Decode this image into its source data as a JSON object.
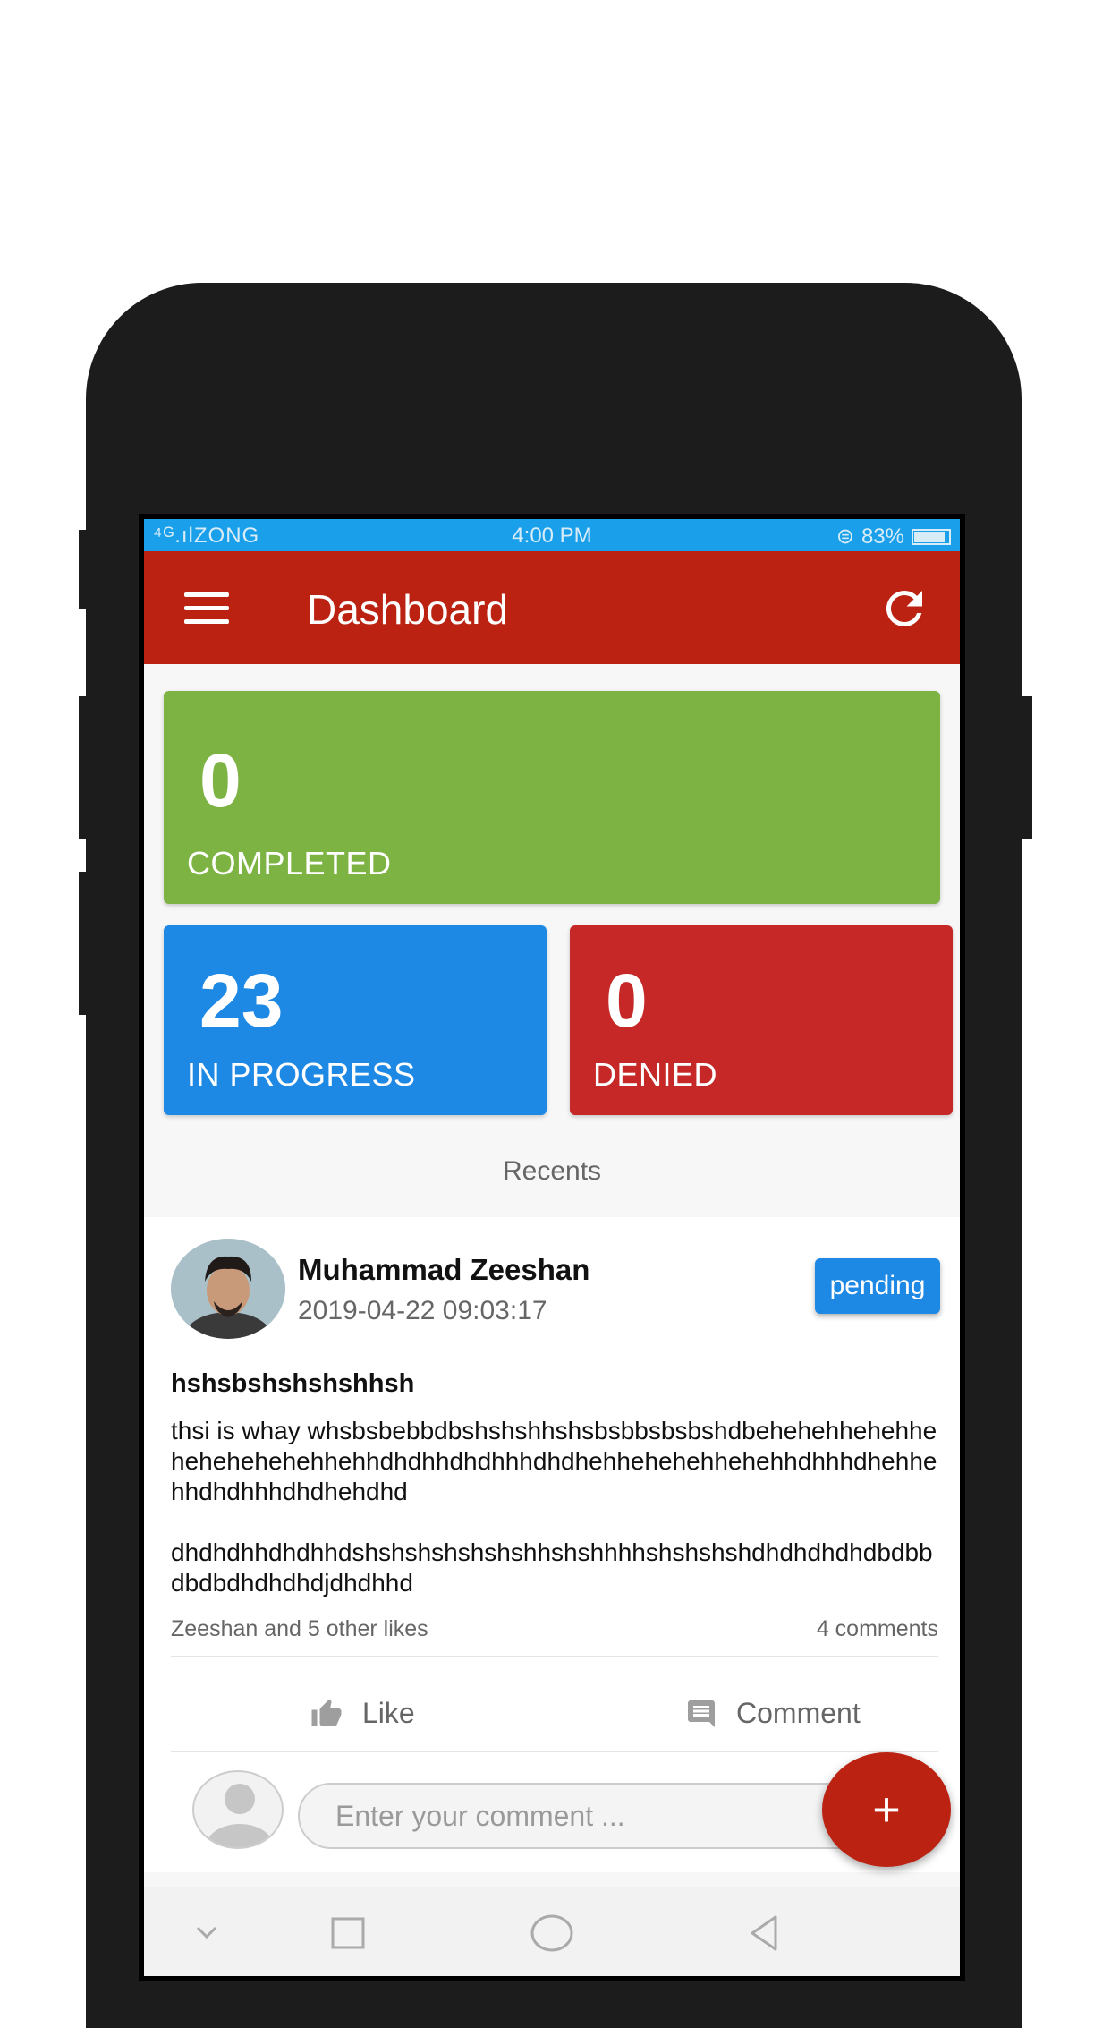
{
  "statusbar": {
    "carrier": "ZONG",
    "time": "4:00 PM",
    "battery": "83%"
  },
  "appbar": {
    "title": "Dashboard"
  },
  "stats": {
    "completed": {
      "count": "0",
      "label": "COMPLETED",
      "color": "#7cb342"
    },
    "in_progress": {
      "count": "23",
      "label": "IN PROGRESS",
      "color": "#1e88e5"
    },
    "denied": {
      "count": "0",
      "label": "DENIED",
      "color": "#c62828"
    }
  },
  "recents_label": "Recents",
  "post": {
    "author": "Muhammad Zeeshan",
    "date": "2019-04-22 09:03:17",
    "status": "pending",
    "title": "hshsbshshshshhsh",
    "body": "thsi is whay whsbsbebbdbshshshhshsbsbbsbsbshdbehehehhehehhehehehehehehhehhdhdhhdhdhhhdhdhehhehehehhehehhdhhhdhehhehhdhdhhhdhdhehdhd\n\ndhdhdhhdhdhhdshshshshshshshhshshhhhshshshshdhdhdhdhdbdbbdbdbdhdhdhdjdhdhhd",
    "likes_text": "Zeeshan and 5 other likes",
    "comments_text": "4 comments",
    "like_label": "Like",
    "comment_label": "Comment",
    "comment_placeholder": "Enter your comment ..."
  },
  "fab_label": "+",
  "icons": {
    "menu": "menu-icon",
    "refresh": "refresh-icon",
    "like": "thumbs-up-icon",
    "comment": "comment-icon",
    "nav": [
      "chevron-down-icon",
      "square-icon",
      "circle-icon",
      "back-triangle-icon"
    ]
  }
}
